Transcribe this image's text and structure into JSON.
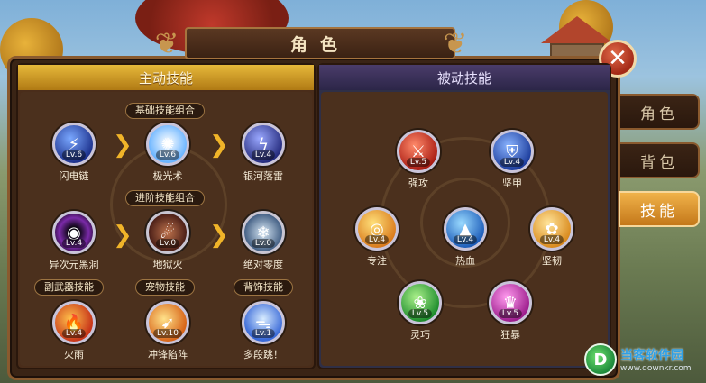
{
  "title": "角色",
  "close_icon": "close-icon",
  "active_section": {
    "label": "主动技能",
    "groups": [
      {
        "label": "基础技能组合",
        "skills": [
          {
            "name": "闪电链",
            "level": "Lv.6",
            "color": "#2d56c8",
            "icon": "lightning-chain-icon"
          },
          {
            "name": "极光术",
            "level": "Lv.6",
            "color": "#c8e4ff",
            "icon": "aurora-icon"
          },
          {
            "name": "银河落雷",
            "level": "Lv.4",
            "color": "#4a5bd8",
            "icon": "galaxy-thunder-icon"
          }
        ]
      },
      {
        "label": "进阶技能组合",
        "skills": [
          {
            "name": "异次元黑洞",
            "level": "Lv.4",
            "color": "#5a1a7a",
            "icon": "black-hole-icon"
          },
          {
            "name": "地狱火",
            "level": "Lv.0",
            "color": "#8a2a1a",
            "icon": "hellfire-icon"
          },
          {
            "name": "绝对零度",
            "level": "Lv.0",
            "color": "#3a7ab8",
            "icon": "absolute-zero-icon"
          }
        ]
      }
    ],
    "extras": [
      {
        "label": "副武器技能",
        "skill": {
          "name": "火雨",
          "level": "Lv.4",
          "color": "#d8581a",
          "icon": "fire-rain-icon"
        }
      },
      {
        "label": "宠物技能",
        "skill": {
          "name": "冲锋陷阵",
          "level": "Lv.10",
          "color": "#e88a1a",
          "icon": "charge-icon"
        }
      },
      {
        "label": "背饰技能",
        "skill": {
          "name": "多段跳！",
          "level": "Lv.1",
          "color": "#4a7ad8",
          "icon": "wing-jump-icon"
        }
      }
    ]
  },
  "passive_section": {
    "label": "被动技能",
    "skills": [
      {
        "name": "强攻",
        "level": "Lv.5",
        "color": "#d8382a",
        "icon": "sword-icon"
      },
      {
        "name": "坚甲",
        "level": "Lv.4",
        "color": "#2a5ac8",
        "icon": "shield-icon"
      },
      {
        "name": "专注",
        "level": "Lv.4",
        "color": "#e8a81a",
        "icon": "target-icon"
      },
      {
        "name": "热血",
        "level": "Lv.4",
        "color": "#2a7ad8",
        "icon": "droplet-icon"
      },
      {
        "name": "坚韧",
        "level": "Lv.4",
        "color": "#e89a1a",
        "icon": "tenacity-icon"
      },
      {
        "name": "灵巧",
        "level": "Lv.5",
        "color": "#2aa83a",
        "icon": "agility-icon"
      },
      {
        "name": "狂暴",
        "level": "Lv.5",
        "color": "#c82ab8",
        "icon": "berserk-icon"
      }
    ]
  },
  "side_tabs": [
    {
      "label": "角色",
      "active": false
    },
    {
      "label": "背包",
      "active": false
    },
    {
      "label": "技能",
      "active": true
    }
  ],
  "watermark": {
    "title": "当客软件园",
    "url": "www.downkr.com"
  }
}
